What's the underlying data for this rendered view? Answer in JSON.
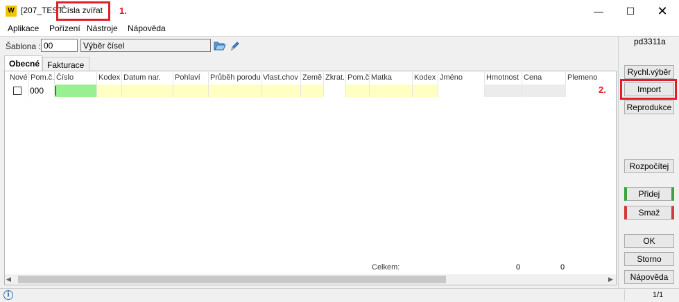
{
  "window": {
    "logo": "W",
    "title_prefix": "[207_TEST",
    "title_main": "Čísla zvířat",
    "annotation1": "1.",
    "min_glyph": "—",
    "max_glyph": "☐",
    "close_glyph": "✕"
  },
  "menu": [
    "Aplikace",
    "Pořízení",
    "Nástroje",
    "Nápověda"
  ],
  "template": {
    "label": "Šablona :",
    "code": "00",
    "name": "Výběr čísel"
  },
  "form_code": "pd3311a",
  "tabs": [
    "Obecné",
    "Fakturace"
  ],
  "grid": {
    "headers": [
      "Nové",
      "Pom.č.",
      "Číslo",
      "Kodex",
      "Datum nar.",
      "Pohlaví",
      "Průběh porodu",
      "Vlast.chov",
      "Země",
      "Zkrat.",
      "Pom.č",
      "Matka",
      "Kodex",
      "Jméno",
      "Hmotnost",
      "Cena",
      "Plemeno"
    ],
    "row": {
      "pom_c": "000"
    },
    "annotation2": "2.",
    "total_label": "Celkem:",
    "total_values": [
      "0",
      "0"
    ]
  },
  "scroll": {
    "left": "◀",
    "right": "▶"
  },
  "buttons": {
    "rychl_vyber": "Rychl.výběr",
    "import": "Import",
    "reprodukce": "Reprodukce",
    "rozpocitej": "Rozpočítej",
    "pridej": "Přidej",
    "smaz": "Smaž",
    "ok": "OK",
    "storno": "Storno",
    "napoveda": "Nápověda"
  },
  "status": {
    "info": "i",
    "page": "1/1"
  }
}
